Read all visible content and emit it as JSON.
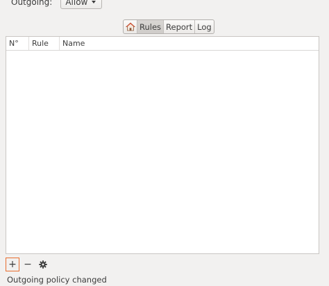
{
  "outgoing": {
    "label": "Outgoing:",
    "policy_value": "Allow"
  },
  "tabs": [
    {
      "label": "",
      "icon": "home-icon"
    },
    {
      "label": "Rules",
      "active": true
    },
    {
      "label": "Report"
    },
    {
      "label": "Log"
    }
  ],
  "table": {
    "columns": [
      "N°",
      "Rule",
      "Name"
    ],
    "rows": []
  },
  "toolbar": {
    "add_label": "+",
    "remove_label": "−"
  },
  "status": {
    "message": "Outgoing policy changed"
  },
  "colors": {
    "focus_ring": "#e86d2e",
    "home_roof": "#d6492b"
  }
}
